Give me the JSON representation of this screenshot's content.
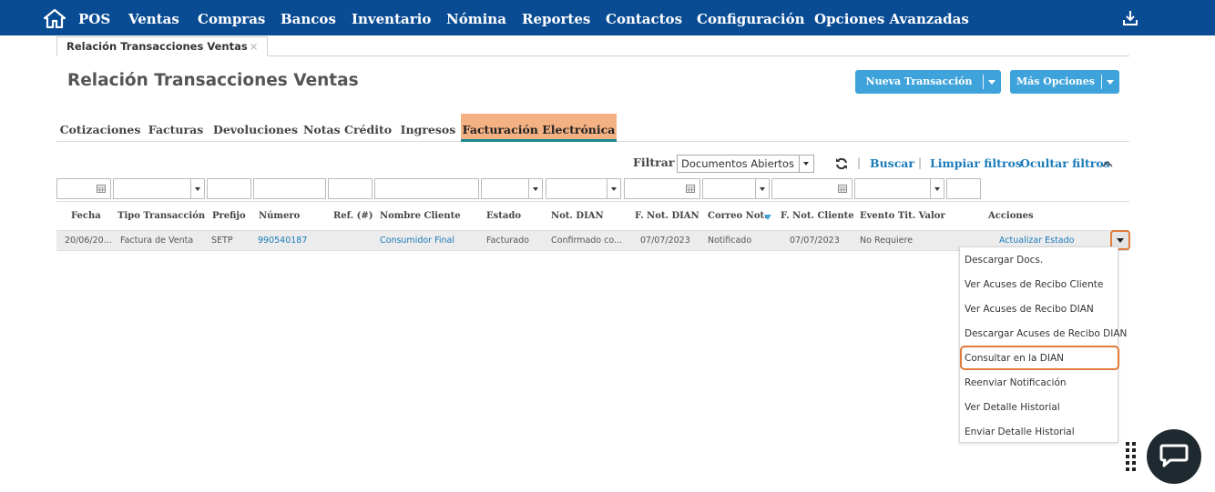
{
  "nav": {
    "items": [
      "POS",
      "Ventas",
      "Compras",
      "Bancos",
      "Inventario",
      "Nómina",
      "Reportes",
      "Contactos",
      "Configuración",
      "Opciones Avanzadas"
    ]
  },
  "doc_tab": {
    "label": "Relación Transacciones Ventas",
    "close": "×"
  },
  "page": {
    "title": "Relación Transacciones Ventas"
  },
  "buttons": {
    "new_transaction": "Nueva Transacción",
    "more_options": "Más Opciones"
  },
  "section_tabs": [
    "Cotizaciones",
    "Facturas",
    "Devoluciones",
    "Notas Crédito",
    "Ingresos",
    "Facturación Electrónica"
  ],
  "active_section_tab": "Facturación Electrónica",
  "filter": {
    "label": "Filtrar",
    "selected": "Documentos Abiertos",
    "search": "Buscar",
    "clear": "Limpiar filtros",
    "hide": "Ocultar filtros",
    "pipe": "|"
  },
  "table": {
    "columns": [
      "Fecha",
      "Tipo Transacción",
      "Prefijo",
      "Número",
      "Ref. (#)",
      "Nombre Cliente",
      "Estado",
      "Not. DIAN",
      "F. Not. DIAN",
      "Correo Not.",
      "F. Not. Cliente",
      "Evento Tit. Valor",
      "Acciones"
    ],
    "rows": [
      {
        "fecha": "20/06/20...",
        "tipo": "Factura de Venta",
        "prefijo": "SETP",
        "numero": "990540187",
        "cliente": "Consumidor Final",
        "estado": "Facturado",
        "not_dian": "Confirmado co...",
        "f_not_dian": "07/07/2023",
        "correo_not": "Notificado",
        "f_not_cliente": "07/07/2023",
        "evento": "No Requiere",
        "accion": "Actualizar Estado"
      }
    ]
  },
  "actions_menu": {
    "items": [
      "Descargar Docs.",
      "Ver Acuses de Recibo Cliente",
      "Ver Acuses de Recibo DIAN",
      "Descargar Acuses de Recibo DIAN",
      "Consultar en la DIAN",
      "Reenviar Notificación",
      "Ver Detalle Historial",
      "Enviar Detalle Historial"
    ],
    "highlighted": "Consultar en la DIAN"
  },
  "colors": {
    "nav_bg": "#0a4c94",
    "button_bg": "#3fa3db",
    "active_tab_bg": "#f4b183",
    "active_tab_underline": "#168a8a",
    "link": "#1a7bb9",
    "highlight_outline": "#e07b39",
    "chat_bg": "#1f2a30"
  },
  "icons": [
    "home-icon",
    "download-icon",
    "refresh-icon",
    "chevron-up-icon",
    "calendar-icon",
    "dropdown-caret-icon",
    "sort-desc-icon",
    "grip-icon",
    "chat-icon"
  ]
}
